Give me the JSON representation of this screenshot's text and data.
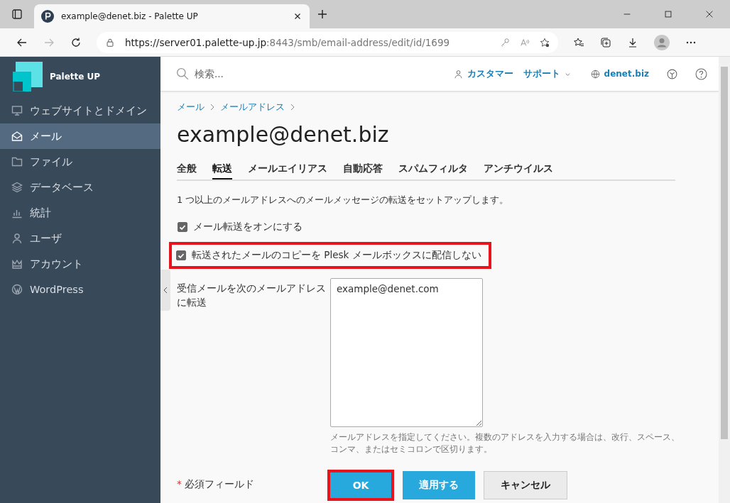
{
  "browser": {
    "tab_title": "example@denet.biz - Palette UP",
    "url_host": "https://server01.palette-up.jp",
    "url_path": ":8443/smb/email-address/edit/id/1699"
  },
  "sidebar": {
    "brand": "Palette UP",
    "items": [
      {
        "label": "ウェブサイトとドメイン",
        "kind": "monitor",
        "selected": false
      },
      {
        "label": "メール",
        "kind": "mail",
        "selected": true
      },
      {
        "label": "ファイル",
        "kind": "folder",
        "selected": false
      },
      {
        "label": "データベース",
        "kind": "layers",
        "selected": false
      },
      {
        "label": "統計",
        "kind": "chart",
        "selected": false
      },
      {
        "label": "ユーザ",
        "kind": "user",
        "selected": false
      },
      {
        "label": "アカウント",
        "kind": "crown",
        "selected": false
      },
      {
        "label": "WordPress",
        "kind": "wordpress",
        "selected": false
      }
    ]
  },
  "topbar": {
    "search_placeholder": "検索...",
    "customer": "カスタマー",
    "support": "サポート",
    "domain": "denet.biz"
  },
  "breadcrumbs": [
    "メール",
    "メールアドレス"
  ],
  "page_title": "example@denet.biz",
  "tabs": [
    {
      "label": "全般",
      "selected": false
    },
    {
      "label": "転送",
      "selected": true
    },
    {
      "label": "メールエイリアス",
      "selected": false
    },
    {
      "label": "自動応答",
      "selected": false
    },
    {
      "label": "スパムフィルタ",
      "selected": false
    },
    {
      "label": "アンチウイルス",
      "selected": false
    }
  ],
  "description": "1 つ以上のメールアドレスへのメールメッセージの転送をセットアップします。",
  "checkboxes": [
    {
      "label": "メール転送をオンにする",
      "checked": true,
      "highlighted": false
    },
    {
      "label": "転送されたメールのコピーを Plesk メールボックスに配信しない",
      "checked": true,
      "highlighted": true
    }
  ],
  "forward_field": {
    "label": "受信メールを次のメールアドレスに転送",
    "value": "example@denet.com",
    "hint": "メールアドレスを指定してください。複数のアドレスを入力する場合は、改行、スペース、コンマ、またはセミコロンで区切ります。"
  },
  "required_note": {
    "mark": "*",
    "text": "必須フィールド"
  },
  "buttons": [
    {
      "label": "OK",
      "kind": "primary",
      "highlighted": true
    },
    {
      "label": "適用する",
      "kind": "primary",
      "highlighted": false
    },
    {
      "label": "キャンセル",
      "kind": "secondary",
      "highlighted": false
    }
  ]
}
